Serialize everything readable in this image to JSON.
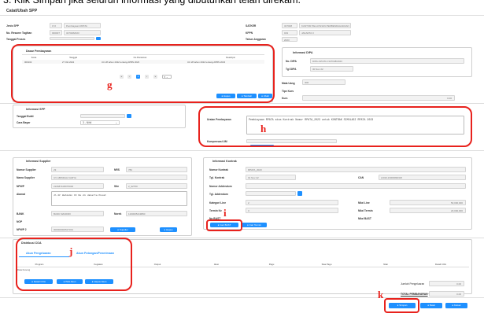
{
  "top_instruction": "3.  Klik Simpan jika seluruh informasi yang dibutuhkan telah direkam.",
  "form_title": "Catat/Ubah SPP",
  "header": {
    "jenis_spp": {
      "label": "Jenis SPP",
      "code": "172",
      "value": "Pembiayaan RPATA"
    },
    "no_resume": {
      "label": "No. Resume Tagihan",
      "code": "000007",
      "value": "3270482023"
    },
    "tanggal_proses": {
      "label": "Tanggal Proses"
    },
    "satker": {
      "label": "SATKER",
      "code": "327048",
      "value": "KANTOR PELAYANAN PERBENDAHARAAN"
    },
    "kppn": {
      "label": "KPPN",
      "code": "019",
      "value": "JAKARTA II"
    },
    "tahun_anggaran": {
      "label": "Tahun Anggaran",
      "value": "2023"
    }
  },
  "dasar_pembayaran": {
    "title": "Dasar Pembayaran",
    "columns": [
      "Kode",
      "Tanggal",
      "No Peraturan",
      "Deskripsi"
    ],
    "rows": [
      [
        "000102",
        "27 Okt 2022",
        "UU 28 tahun 2022 tentang APBN 2023",
        "UU 28 tahun 2022 tentang APBN 2023"
      ]
    ],
    "pagination": {
      "first": "«",
      "prev": "‹",
      "current": "1",
      "next": "›",
      "last": "»",
      "page_size": "5"
    },
    "buttons": {
      "hapus": "Hapus",
      "tambah": "Tambah",
      "ubah": "Ubah"
    }
  },
  "informasi_dipa": {
    "title": "Informasi DIPA",
    "no_dipa": {
      "label": "No. DIPA",
      "value": "DIPA-015.05.2.327048/2023"
    },
    "tgl_dipa": {
      "label": "Tgl DIPA",
      "value": "30 Nov 22"
    },
    "mata_uang": {
      "label": "Mata Uang",
      "value": "IDR"
    },
    "tipe_kurs": {
      "label": "Tipe Kurs"
    },
    "kurs": {
      "label": "Kurs",
      "value": "0.00"
    }
  },
  "informasi_spp": {
    "title": "Informasi SPP",
    "tanggal_bukti": {
      "label": "Tanggal Bukti"
    },
    "cara_bayar": {
      "label": "Cara Bayar",
      "value": "3 - Nihil"
    }
  },
  "uraian": {
    "label": "Uraian Pembayaran",
    "value": "Pembiayaan RPATA atas Kontrak Nomor RPATA_2023 untuk KONTRAK SIMULASI RPATA 2023",
    "kompensasi_label": "Kompensasi UM"
  },
  "informasi_supplier": {
    "title": "Informasi Supplier",
    "nomor_supplier": {
      "label": "Nomor Supplier",
      "value": "23"
    },
    "nrs": {
      "label": "NRS",
      "value": "782"
    },
    "nama_supplier": {
      "label": "Nama Supplier",
      "value": "CV ABINDAH KARYA"
    },
    "npwp": {
      "label": "NPWP",
      "value": "210687108075000"
    },
    "site": {
      "label": "Site",
      "value": "2_92750"
    },
    "alamat": {
      "label": "Alamat",
      "value": "Jl.Dr Wahidin II No.11 Jakarta Pusat"
    },
    "bank": {
      "label": "BANK",
      "value": "BANK MANDIRI"
    },
    "norek": {
      "label": "Norek",
      "value": "1190005219890"
    },
    "nop": {
      "label": "NOP"
    },
    "npwp2": {
      "label": "NPWP 2",
      "value": "000000000527001"
    },
    "btn_supplier": "Supplier",
    "btn_hapus": "Hapus"
  },
  "informasi_kontrak": {
    "title": "Informasi Kontrak",
    "nomor_kontrak": {
      "label": "Nomor Kontrak",
      "value": "RPATA_2023"
    },
    "tgl_kontrak": {
      "label": "Tgl. Kontrak",
      "value": "01 Nov 22"
    },
    "can": {
      "label": "CAN",
      "value": "A/019.23009999/0/0"
    },
    "nomor_addendum": {
      "label": "Nomor Addendum"
    },
    "tgl_addendum": {
      "label": "Tgl. Addendum"
    },
    "kategori_line": {
      "label": "Kategori Line",
      "value": "2"
    },
    "termin_ke": {
      "label": "Termin Ke",
      "value": "3"
    },
    "no_bast": {
      "label": "No BAST"
    },
    "nilai_line": {
      "label": "Nilai Line",
      "value": "50,000,000"
    },
    "nilai_termin": {
      "label": "Nilai Termin",
      "value": "20,000,000"
    },
    "nilai_bast": {
      "label": "Nilai BAST"
    },
    "btn_cari_bast": "Cari BAST",
    "btn_cari_termin": "Cari Termin"
  },
  "distribusi_coa": {
    "title": "Distribusi COA",
    "tabs": [
      "Akun Pengeluaran",
      "Akun Potongan/Penerimaan"
    ],
    "columns": [
      "Program",
      "Kegiatan",
      "Output",
      "Akun",
      "Pagu",
      "Sisa Pagu",
      "Nilai",
      "Detail COA"
    ],
    "empty_text": "Data Kosong",
    "buttons": {
      "detail": "Detail COA",
      "isi": "ISIH Akun",
      "hapus": "Hapus Akun"
    },
    "jumlah_label": "Jumlah Pengeluaran",
    "jumlah_value": "0.00",
    "total_label": "TOTAL PEMBAYARAN",
    "total_value": "0.00"
  },
  "footer": {
    "simpan": "Simpan",
    "batal": "Batal",
    "keluar": "Keluar"
  },
  "markers": {
    "g": "g",
    "h": "h",
    "i": "i",
    "j": "j",
    "k": "k"
  },
  "colors": {
    "accent": "#1e90ff",
    "highlight": "#e8221d"
  }
}
